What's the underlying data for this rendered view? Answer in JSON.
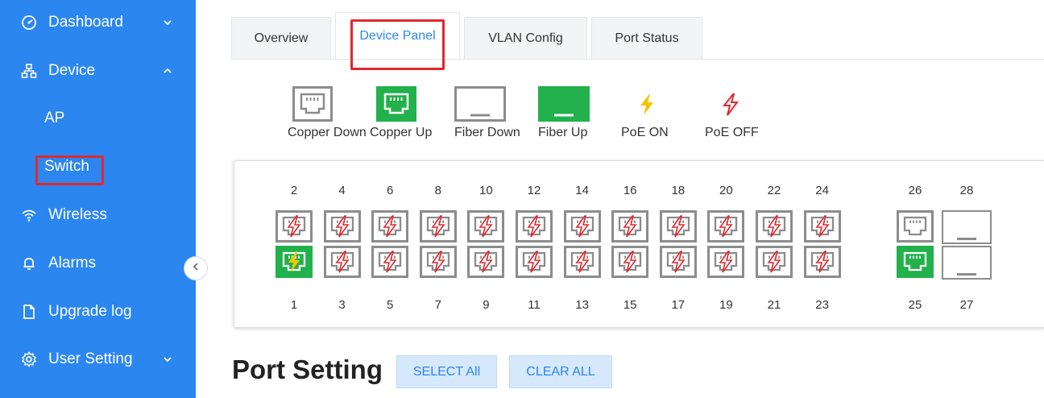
{
  "sidebar": {
    "dashboard": "Dashboard",
    "device": "Device",
    "ap": "AP",
    "switch": "Switch",
    "wireless": "Wireless",
    "alarms": "Alarms",
    "upgrade_log": "Upgrade log",
    "user_setting": "User Setting"
  },
  "tabs": {
    "overview": "Overview",
    "device_panel": "Device Panel",
    "vlan_config": "VLAN Config",
    "port_status": "Port Status"
  },
  "legend": {
    "copper_down": "Copper Down",
    "copper_up": "Copper Up",
    "fiber_down": "Fiber Down",
    "fiber_up": "Fiber Up",
    "poe_on": "PoE ON",
    "poe_off": "PoE OFF"
  },
  "ports": {
    "top_numbers": [
      "2",
      "4",
      "6",
      "8",
      "10",
      "12",
      "14",
      "16",
      "18",
      "20",
      "22",
      "24"
    ],
    "bottom_numbers": [
      "1",
      "3",
      "5",
      "7",
      "9",
      "11",
      "13",
      "15",
      "17",
      "19",
      "21",
      "23"
    ],
    "uplink_top": [
      "26",
      "28"
    ],
    "uplink_bottom": [
      "25",
      "27"
    ],
    "states": {
      "1": "copper-up-poe-on",
      "25": "copper-up",
      "26": "copper-down",
      "27": "fiber-down",
      "28": "fiber-down",
      "others": "copper-down-poe-off"
    }
  },
  "port_setting": {
    "title": "Port Setting",
    "select_all": "SELECT All",
    "clear_all": "CLEAR ALL"
  },
  "colors": {
    "sidebar": "#2b86f0",
    "up_green": "#22b14c",
    "poe_on_yellow": "#f5c400",
    "poe_off_red": "#e0282e",
    "highlight_red": "#e0282e"
  }
}
